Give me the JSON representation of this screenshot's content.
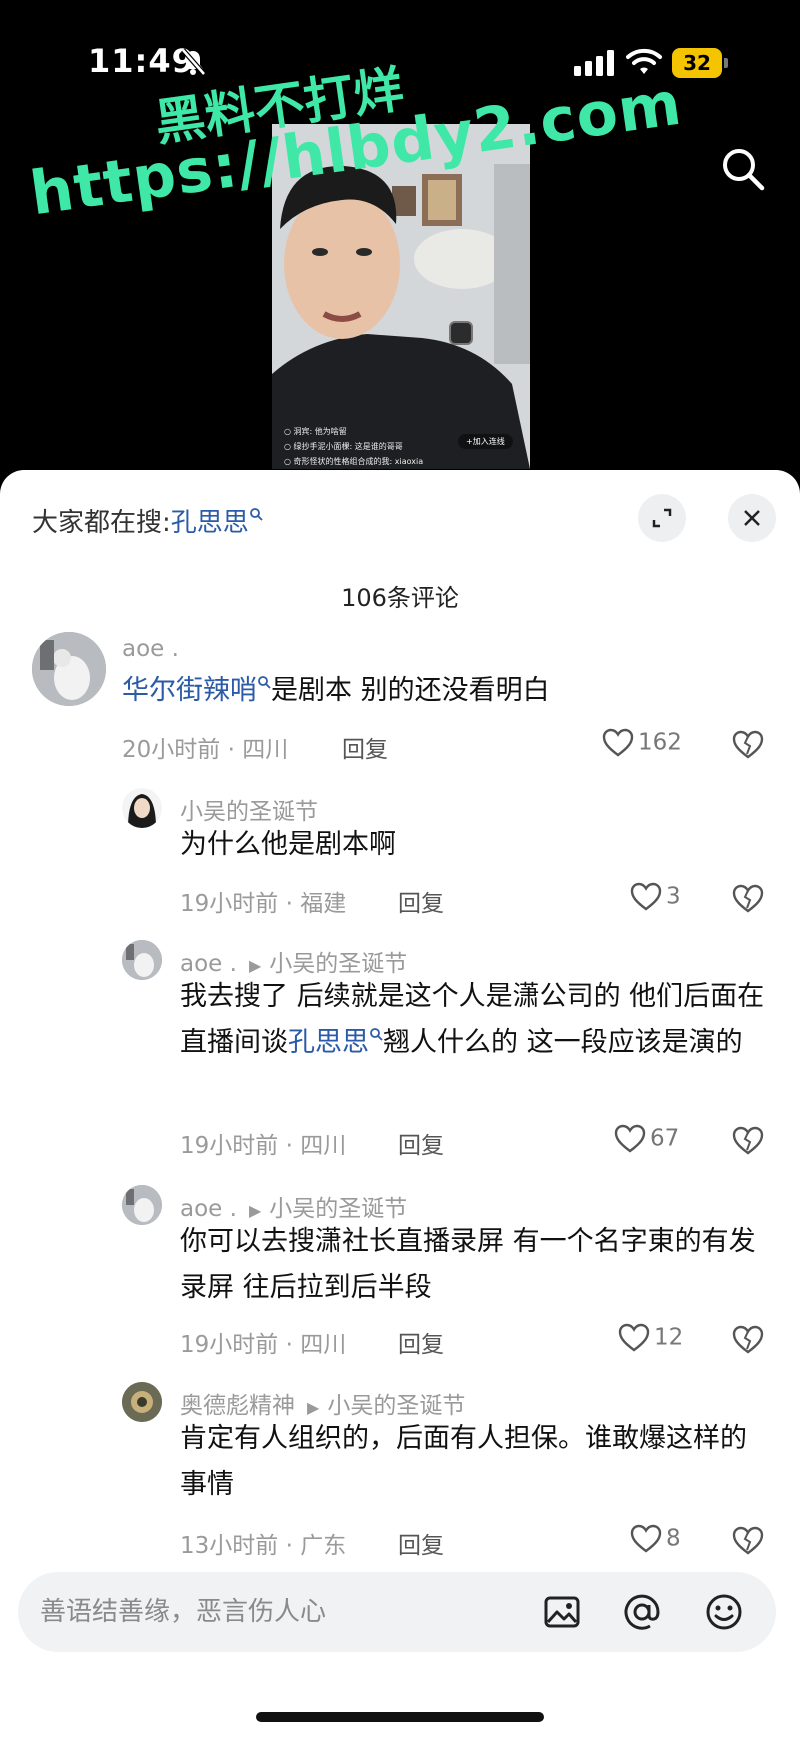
{
  "status": {
    "time": "11:49",
    "battery": "32"
  },
  "watermark": {
    "line1": "黑料不打烊",
    "line2": "https://hlbdy2.com"
  },
  "video": {
    "chat_lines": [
      "○ 洞宾: 他为啥留",
      "○ 绿抄手泥小面棵: 这是谁的哥哥",
      "○ 奇形怪状的性格组合成的我: xiaoxia"
    ],
    "join_label": "+加入连线"
  },
  "sheet": {
    "search_prefix": "大家都在搜:",
    "search_term": "孔思思",
    "comment_count": "106条评论"
  },
  "comments": [
    {
      "user": "aoe .",
      "text_link": "华尔街辣哨",
      "text_rest": "是剧本   别的还没看明白",
      "meta": "20小时前 · 四川",
      "reply": "回复",
      "likes": "162"
    },
    {
      "user": "小吴的圣诞节",
      "text": "为什么他是剧本啊",
      "meta": "19小时前 · 福建",
      "reply": "回复",
      "likes": "3"
    },
    {
      "user": "aoe .",
      "reply_to": "小吴的圣诞节",
      "text_a": "我去搜了   后续就是这个人是潇公司的   他们后面在直播间谈",
      "text_link": "孔思思",
      "text_b": "翘人什么的   这一段应该是演的",
      "meta": "19小时前 · 四川",
      "reply": "回复",
      "likes": "67"
    },
    {
      "user": "aoe .",
      "reply_to": "小吴的圣诞节",
      "text": "你可以去搜潇社长直播录屏   有一个名字東的有发录屏   往后拉到后半段",
      "meta": "19小时前 · 四川",
      "reply": "回复",
      "likes": "12"
    },
    {
      "user": "奥德彪精神",
      "reply_to": "小吴的圣诞节",
      "text": "肯定有人组织的，后面有人担保。谁敢爆这样的事情",
      "meta": "13小时前 · 广东",
      "reply": "回复",
      "likes": "8"
    }
  ],
  "input": {
    "placeholder": "善语结善缘，恶言伤人心"
  }
}
